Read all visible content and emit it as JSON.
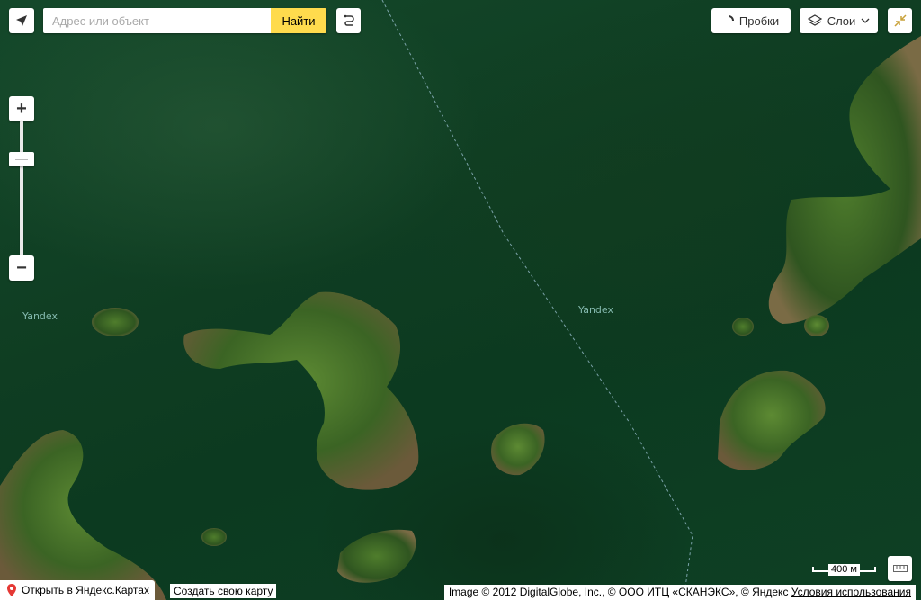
{
  "search": {
    "placeholder": "Адрес или объект",
    "button_label": "Найти"
  },
  "controls": {
    "traffic_label": "Пробки",
    "layers_label": "Слои",
    "zoom_in_label": "+",
    "zoom_out_label": "−"
  },
  "map": {
    "watermark_left": "Yandex",
    "watermark_right": "Yandex",
    "scale_label": "400 м"
  },
  "footer": {
    "open_in_maps": "Открыть в Яндекс.Картах",
    "create_map": "Создать свою карту",
    "copyright": "Image © 2012 DigitalGlobe, Inc., © ООО ИТЦ «СКАНЭКС», © Яндекс",
    "terms": "Условия использования"
  },
  "colors": {
    "search_button": "#ffdb4d",
    "water": "#0f3d22",
    "land": "#3f6a2a",
    "pin": "#e53935"
  }
}
